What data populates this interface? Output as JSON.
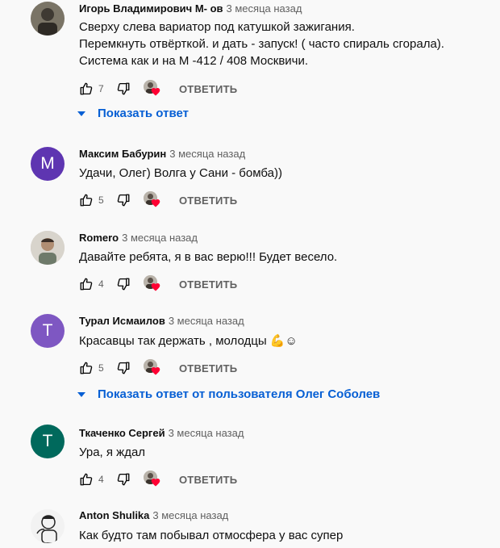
{
  "icons": {
    "like": "thumb-up-icon",
    "dislike": "thumb-down-icon",
    "hearted": "creator-heart-icon",
    "expand": "triangle-down-icon"
  },
  "colors": {
    "background": "#f9f9f9",
    "link": "#065fd4",
    "heart": "#ff0033"
  },
  "comments": [
    {
      "author": "Игорь Владимирович М- ов",
      "time": "3 месяца назад",
      "avatar": {
        "type": "photo",
        "letter": ""
      },
      "lines": [
        "Сверху слева вариатор под катушкой зажигания.",
        "Перемкнуть отвёрткой. и дать - запуск! ( часто спираль сгорала).",
        "Система как и на М -412 / 408 Москвичи."
      ],
      "likes": "7",
      "reply_label": "ОТВЕТИТЬ",
      "show_replies": "Показать ответ"
    },
    {
      "author": "Максим Бабурин",
      "time": "3 месяца назад",
      "avatar": {
        "type": "letter",
        "letter": "М",
        "color": "#5e35b1"
      },
      "lines": [
        "Удачи, Олег) Волга у Сани - бомба))"
      ],
      "likes": "5",
      "reply_label": "ОТВЕТИТЬ"
    },
    {
      "author": "Romero",
      "time": "3 месяца назад",
      "avatar": {
        "type": "photo",
        "letter": ""
      },
      "lines": [
        "Давайте ребята, я в вас верю!!! Будет весело."
      ],
      "likes": "4",
      "reply_label": "ОТВЕТИТЬ"
    },
    {
      "author": "Турал Исмаилов",
      "time": "3 месяца назад",
      "avatar": {
        "type": "letter",
        "letter": "Т",
        "color": "#7e57c2"
      },
      "lines": [
        "Красавцы так держать , молодцы 💪☺"
      ],
      "likes": "5",
      "reply_label": "ОТВЕТИТЬ",
      "show_replies": "Показать ответ от пользователя Олег Соболев"
    },
    {
      "author": "Ткаченко Сергей",
      "time": "3 месяца назад",
      "avatar": {
        "type": "letter",
        "letter": "Т",
        "color": "#00695c"
      },
      "lines": [
        "Ура, я ждал"
      ],
      "likes": "4",
      "reply_label": "ОТВЕТИТЬ"
    },
    {
      "author": "Anton Shulika",
      "time": "3 месяца назад",
      "avatar": {
        "type": "photo",
        "letter": ""
      },
      "lines": [
        "Как будто там побывал отмосфера у вас супер"
      ]
    }
  ]
}
